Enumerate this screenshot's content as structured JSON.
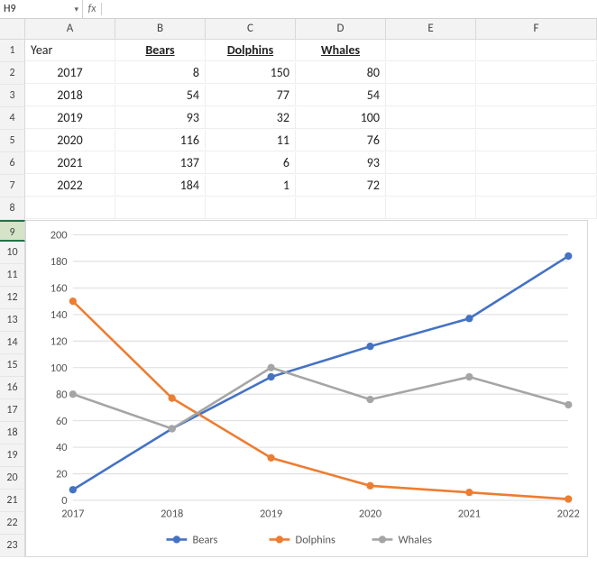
{
  "namebox": {
    "cell_ref": "H9",
    "formula": ""
  },
  "fx_label": "fx",
  "col_headers": [
    "A",
    "B",
    "C",
    "D",
    "E",
    "F"
  ],
  "row_headers": [
    "1",
    "2",
    "3",
    "4",
    "5",
    "6",
    "7",
    "8",
    "9",
    "10",
    "11",
    "12",
    "13",
    "14",
    "15",
    "16",
    "17",
    "18",
    "19",
    "20",
    "21",
    "22",
    "23"
  ],
  "selected_row": "9",
  "table": {
    "head": {
      "year": "Year",
      "bears": "Bears",
      "dolphins": "Dolphins",
      "whales": "Whales"
    },
    "rows": [
      {
        "year": "2017",
        "bears": "8",
        "dolphins": "150",
        "whales": "80"
      },
      {
        "year": "2018",
        "bears": "54",
        "dolphins": "77",
        "whales": "54"
      },
      {
        "year": "2019",
        "bears": "93",
        "dolphins": "32",
        "whales": "100"
      },
      {
        "year": "2020",
        "bears": "116",
        "dolphins": "11",
        "whales": "76"
      },
      {
        "year": "2021",
        "bears": "137",
        "dolphins": "6",
        "whales": "93"
      },
      {
        "year": "2022",
        "bears": "184",
        "dolphins": "1",
        "whales": "72"
      }
    ]
  },
  "chart_legend": {
    "bears": "Bears",
    "dolphins": "Dolphins",
    "whales": "Whales"
  },
  "y_ticks": [
    "0",
    "20",
    "40",
    "60",
    "80",
    "100",
    "120",
    "140",
    "160",
    "180",
    "200"
  ],
  "x_ticks": [
    "2017",
    "2018",
    "2019",
    "2020",
    "2021",
    "2022"
  ],
  "chart_data": {
    "type": "line",
    "title": "",
    "xlabel": "",
    "ylabel": "",
    "ylim": [
      0,
      200
    ],
    "categories": [
      "2017",
      "2018",
      "2019",
      "2020",
      "2021",
      "2022"
    ],
    "series": [
      {
        "name": "Bears",
        "values": [
          8,
          54,
          93,
          116,
          137,
          184
        ]
      },
      {
        "name": "Dolphins",
        "values": [
          150,
          77,
          32,
          11,
          6,
          1
        ]
      },
      {
        "name": "Whales",
        "values": [
          80,
          54,
          100,
          76,
          93,
          72
        ]
      }
    ]
  }
}
